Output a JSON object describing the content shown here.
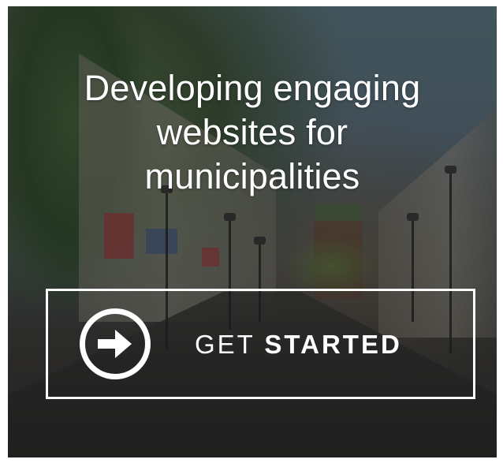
{
  "hero": {
    "headline_lines": [
      "Developing engaging",
      "websites for",
      "municipalities"
    ]
  },
  "cta": {
    "label_light": "GET",
    "label_bold": "STARTED",
    "icon": "arrow-right-circle-icon"
  },
  "colors": {
    "text": "#ffffff",
    "border": "#ffffff",
    "overlay": "rgba(20,24,24,0.38)"
  },
  "background_image": "city pedestrian street with buildings, trees and street lamps"
}
